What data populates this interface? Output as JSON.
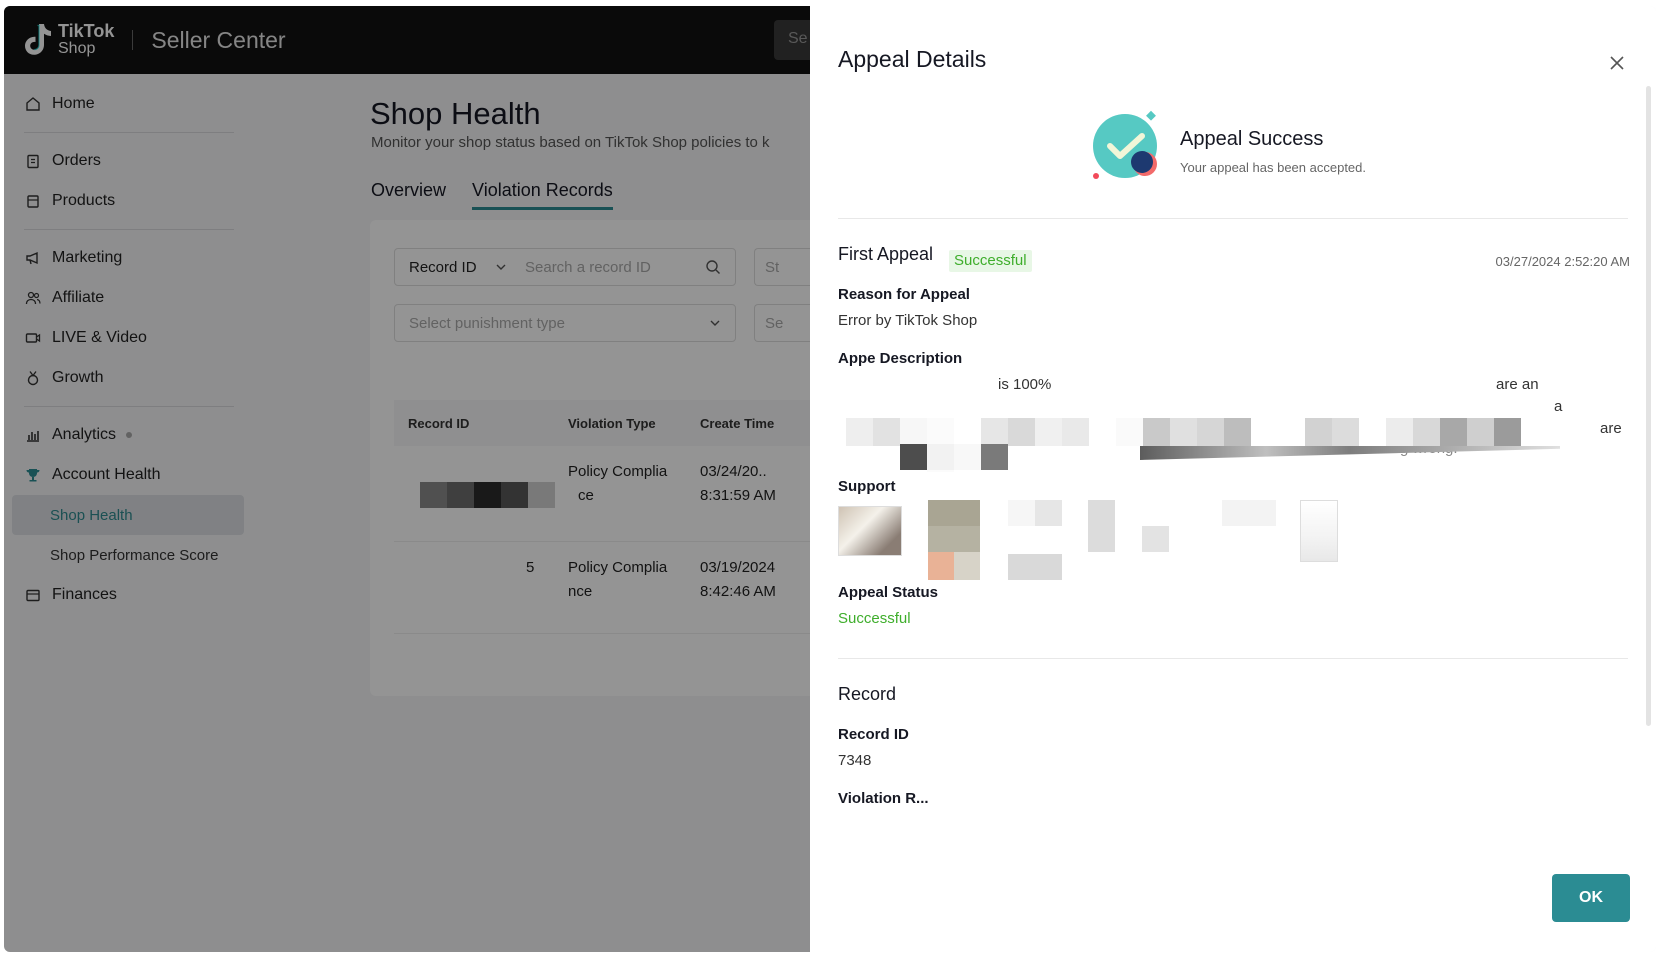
{
  "header": {
    "logo_line1": "TikTok",
    "logo_line2": "Shop",
    "app_title": "Seller Center",
    "search_stub": "Se"
  },
  "sidebar": {
    "items": [
      {
        "label": "Home",
        "icon": "home-icon"
      },
      {
        "label": "Orders",
        "icon": "clipboard-icon"
      },
      {
        "label": "Products",
        "icon": "box-icon"
      },
      {
        "label": "Marketing",
        "icon": "megaphone-icon"
      },
      {
        "label": "Affiliate",
        "icon": "people-icon"
      },
      {
        "label": "LIVE & Video",
        "icon": "video-icon"
      },
      {
        "label": "Growth",
        "icon": "medal-icon"
      },
      {
        "label": "Analytics",
        "icon": "bar-chart-icon"
      },
      {
        "label": "Account Health",
        "icon": "trophy-icon"
      },
      {
        "label": "Finances",
        "icon": "wallet-icon"
      }
    ],
    "sub_items": [
      "Shop Health",
      "Shop Performance Score"
    ],
    "active_sub": "Shop Health"
  },
  "main": {
    "title": "Shop Health",
    "subtitle": "Monitor your shop status based on TikTok Shop policies to k",
    "tabs": [
      "Overview",
      "Violation Records"
    ],
    "active_tab": "Violation Records",
    "filter_record_select": "Record ID",
    "filter_record_placeholder": "Search a record ID",
    "filter_punishment_placeholder": "Select punishment type",
    "filter_stub_1": "St",
    "filter_stub_2": "Se",
    "table_headers": [
      "Record ID",
      "Violation Type",
      "Create Time"
    ],
    "rows": [
      {
        "record_id": "",
        "type_l1": "Policy Complia",
        "type_l2": "ce",
        "time_l1": "03/24/20..",
        "time_l2": "8:31:59 AM"
      },
      {
        "record_id": "5",
        "type_l1": "Policy Complia",
        "type_l2": "nce",
        "time_l1": "03/19/2024",
        "time_l2": "8:42:46 AM"
      }
    ]
  },
  "drawer": {
    "title": "Appeal Details",
    "success_title": "Appeal Success",
    "success_sub": "Your appeal has been accepted.",
    "first_appeal": "First Appeal",
    "first_appeal_badge": "Successful",
    "timestamp": "03/27/2024 2:52:20 AM",
    "reason_label": "Reason for Appeal",
    "reason_value": "Error by TikTok Shop",
    "desc_label": "Appe  Description",
    "desc_frag_1": "is 100%",
    "desc_frag_2": "are an",
    "desc_frag_3": "a",
    "desc_frag_4": "are",
    "desc_frag_5": "ning wrong.",
    "support_label": "Support",
    "status_label": "Appeal Status",
    "status_value": "Successful",
    "record_title": "Record",
    "record_id_label": "Record ID",
    "record_id_value": "7348",
    "violation_label": "Violation R...",
    "ok": "OK"
  },
  "colors": {
    "accent": "#2b8c93",
    "success_green": "#3fae2c",
    "header_bg": "#121212"
  }
}
